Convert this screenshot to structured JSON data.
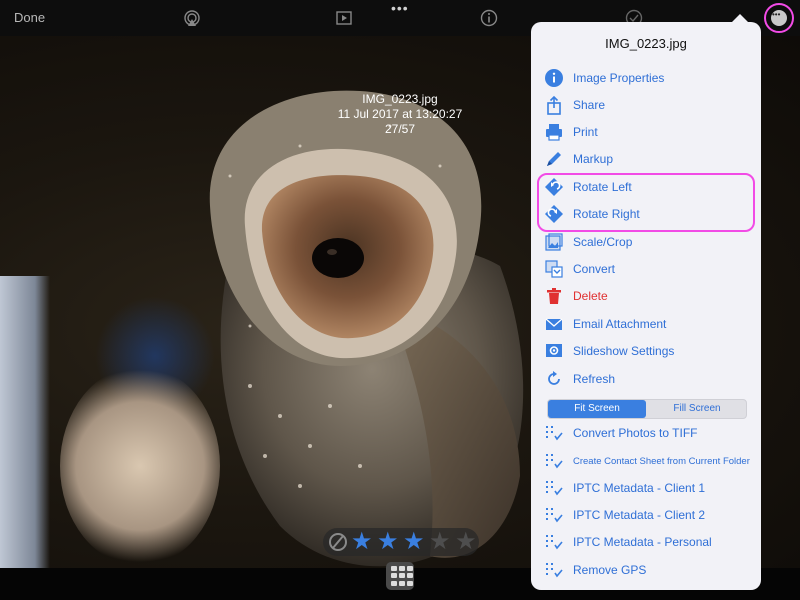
{
  "toolbar": {
    "done_label": "Done",
    "icons": [
      "airplay-icon",
      "slideshow-icon",
      "more-dots-icon",
      "info-icon",
      "check-icon",
      "more-menu-icon"
    ]
  },
  "photo": {
    "filename": "IMG_0223.jpg",
    "datetime": "11 Jul 2017 at 13:20:27",
    "position": "27/57"
  },
  "rating": {
    "stars": 3,
    "max": 5
  },
  "menu": {
    "title": "IMG_0223.jpg",
    "items": [
      {
        "label": "Image Properties",
        "icon": "info-icon"
      },
      {
        "label": "Share",
        "icon": "share-icon"
      },
      {
        "label": "Print",
        "icon": "print-icon"
      },
      {
        "label": "Markup",
        "icon": "pencil-icon"
      },
      {
        "label": "Rotate Left",
        "icon": "rotate-left-icon"
      },
      {
        "label": "Rotate Right",
        "icon": "rotate-right-icon"
      },
      {
        "label": "Scale/Crop",
        "icon": "crop-icon"
      },
      {
        "label": "Convert",
        "icon": "convert-icon"
      },
      {
        "label": "Delete",
        "icon": "trash-icon",
        "color": "#e03131"
      },
      {
        "label": "Email Attachment",
        "icon": "mail-icon"
      },
      {
        "label": "Slideshow Settings",
        "icon": "slideshow-settings-icon"
      },
      {
        "label": "Refresh",
        "icon": "refresh-icon"
      }
    ],
    "segment": {
      "options": [
        "Fit Screen",
        "Fill Screen"
      ],
      "selected": "Fit Screen"
    },
    "actions": [
      {
        "label": "Convert Photos to TIFF"
      },
      {
        "label": "Create Contact Sheet from Current Folder"
      },
      {
        "label": "IPTC Metadata - Client 1"
      },
      {
        "label": "IPTC Metadata - Client 2"
      },
      {
        "label": "IPTC Metadata - Personal"
      },
      {
        "label": "Remove GPS"
      }
    ]
  },
  "colors": {
    "accent": "#3a7fe0",
    "link": "#2f6fd6",
    "destructive": "#e03131",
    "highlight": "#f24be6"
  }
}
